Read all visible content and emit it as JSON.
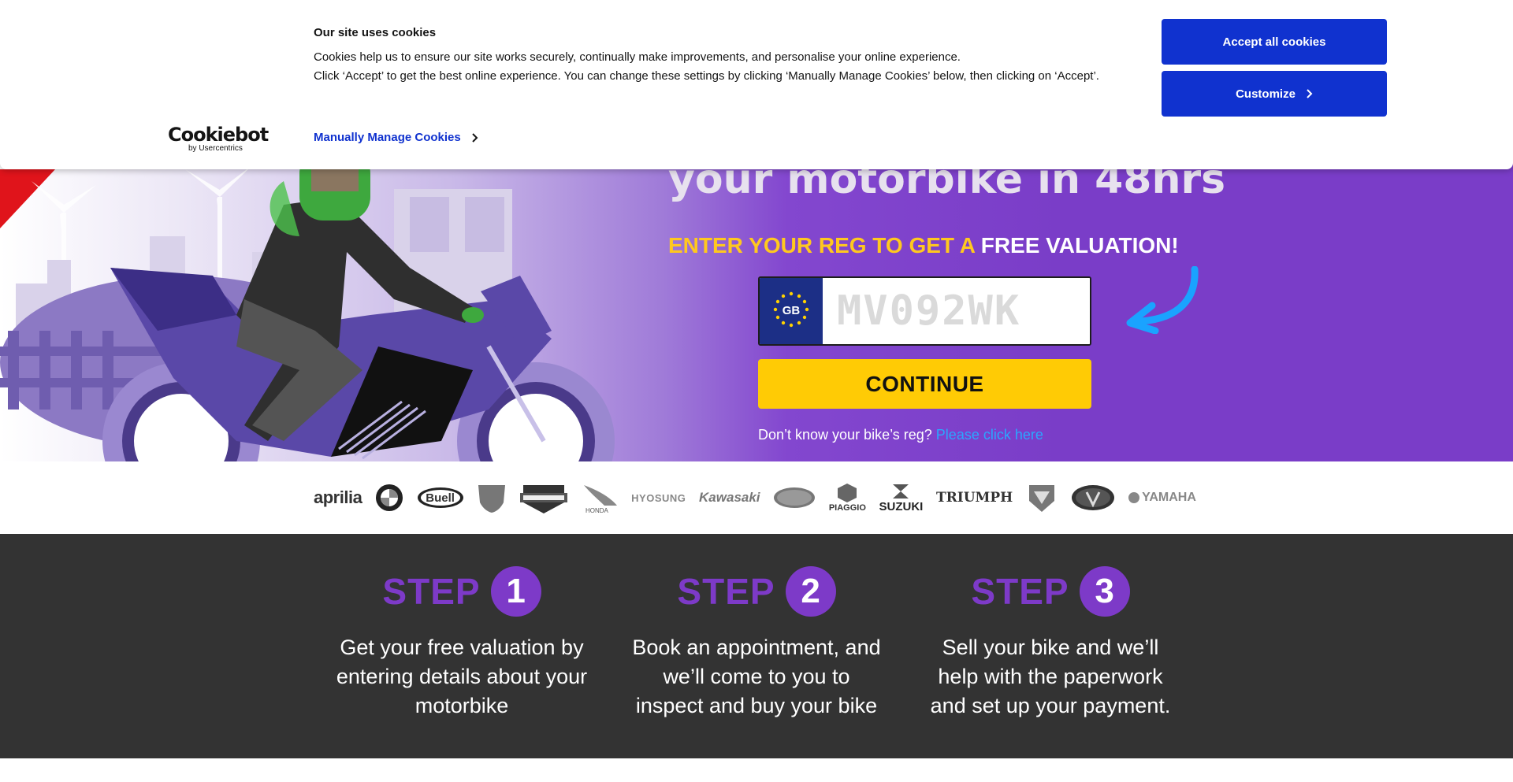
{
  "cookie_banner": {
    "logo_main": "Cookiebot",
    "logo_sub": "by Usercentrics",
    "title": "Our site uses cookies",
    "text_line1": "Cookies help us to ensure our site works securely, continually make improvements, and personalise your online experience.",
    "text_line2": "Click ‘Accept’ to get the best online experience. You can change these settings by clicking ‘Manually Manage Cookies’ below, then clicking on ‘Accept’.",
    "manage_link": "Manually Manage Cookies",
    "accept_button": "Accept all cookies",
    "customize_button": "Customize",
    "accent_color": "#1032cf"
  },
  "hero": {
    "title_visible": "your motorbike in 48hrs",
    "reg_prompt_highlight": "ENTER YOUR REG TO GET A",
    "reg_prompt_rest": "FREE VALUATION!",
    "plate_country": "GB",
    "reg_placeholder": "MV092WK",
    "continue_label": "CONTINUE",
    "help_text": "Don’t know your bike’s reg?",
    "help_link": "Please click here",
    "colors": {
      "background": "#7a3dc8",
      "highlight": "#ffc81f",
      "button": "#ffcb05",
      "link": "#2aa7ff"
    }
  },
  "brands": [
    {
      "name": "aprilia"
    },
    {
      "name": "BMW"
    },
    {
      "name": "Buell"
    },
    {
      "name": "DUCATI"
    },
    {
      "name": "HARLEY-DAVIDSON"
    },
    {
      "name": "HONDA"
    },
    {
      "name": "HYOSUNG"
    },
    {
      "name": "Kawasaki"
    },
    {
      "name": "Moto Guzzi"
    },
    {
      "name": "PIAGGIO"
    },
    {
      "name": "SUZUKI"
    },
    {
      "name": "TRIUMPH"
    },
    {
      "name": "KTM"
    },
    {
      "name": "VICTORY"
    },
    {
      "name": "YAMAHA"
    }
  ],
  "steps": [
    {
      "label": "STEP",
      "number": "1",
      "text": "Get your free valuation by entering details about your motorbike"
    },
    {
      "label": "STEP",
      "number": "2",
      "text": "Book an appointment, and we’ll come to you to inspect and buy your bike"
    },
    {
      "label": "STEP",
      "number": "3",
      "text": "Sell your bike and we’ll help with the paperwork and set up your payment."
    }
  ]
}
